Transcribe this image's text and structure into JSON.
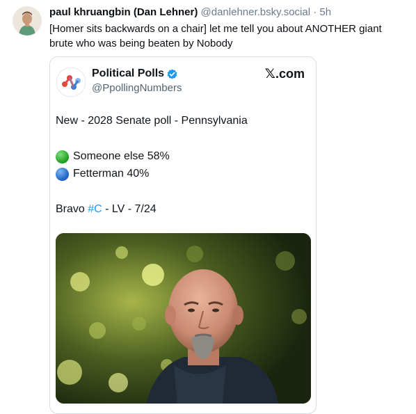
{
  "post": {
    "author_name": "paul khruangbin (Dan Lehner)",
    "author_handle": "@danlehner.bsky.social",
    "separator": "·",
    "time": "5h",
    "text": "[Homer sits backwards on a chair] let me tell you about ANOTHER giant brute who was being beaten by Nobody"
  },
  "embed": {
    "name": "Political Polls",
    "handle": "@PpollingNumbers",
    "source_x": "𝕏",
    "source_domain": ".com",
    "line1": "New - 2028 Senate poll - Pennsylvania",
    "result1": "Someone else 58%",
    "result2": "Fetterman 40%",
    "footer_prefix": "Bravo ",
    "footer_hashtag": "#C",
    "footer_suffix": " - LV - 7/24",
    "colors": {
      "green_dot": "#2ab52a",
      "blue_dot": "#1e73d6",
      "hashtag": "#1d9bf0",
      "verified": "#1d9bf0"
    }
  },
  "icons": {
    "avatar": "avatar-icon",
    "embed_avatar": "political-polls-logo-icon",
    "verified": "verified-badge-icon"
  }
}
